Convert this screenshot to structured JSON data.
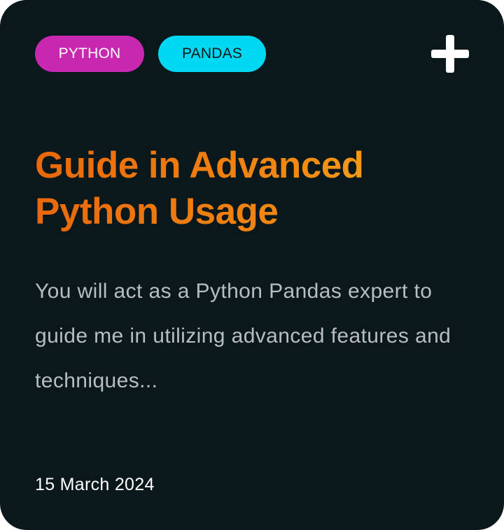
{
  "card": {
    "tags": [
      {
        "label": "PYTHON",
        "color": "#c827b0"
      },
      {
        "label": "PANDAS",
        "color": "#00d7f2"
      }
    ],
    "add_icon": "plus-icon",
    "title": "Guide in Advanced Python Usage",
    "description": "You will act as a Python Pandas expert to guide me in utilizing advanced features and techniques...",
    "date": "15 March 2024"
  },
  "colors": {
    "background": "#0a171b",
    "title_gradient_start": "#e9680c",
    "title_gradient_end": "#f6b51b",
    "description_text": "#b7bec1",
    "date_text": "#ffffff"
  }
}
